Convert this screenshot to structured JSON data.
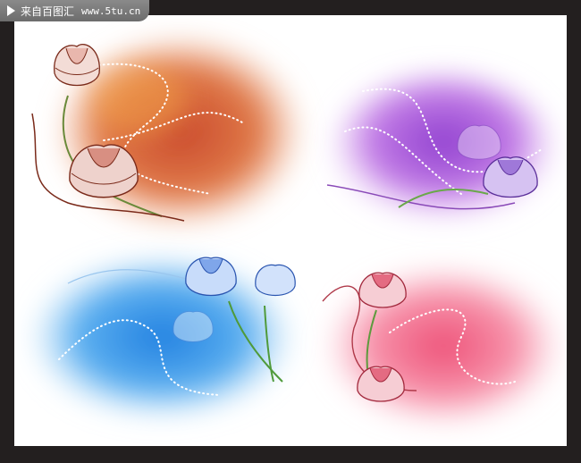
{
  "watermark": {
    "icon": "play-triangle-icon",
    "label": "来自百图汇",
    "site": "www.5tu.cn"
  },
  "panels": [
    {
      "name": "orange",
      "color": "#d8603a"
    },
    {
      "name": "purple",
      "color": "#a35ad6"
    },
    {
      "name": "blue",
      "color": "#2f8ee0"
    },
    {
      "name": "pink",
      "color": "#f06a8a"
    }
  ]
}
